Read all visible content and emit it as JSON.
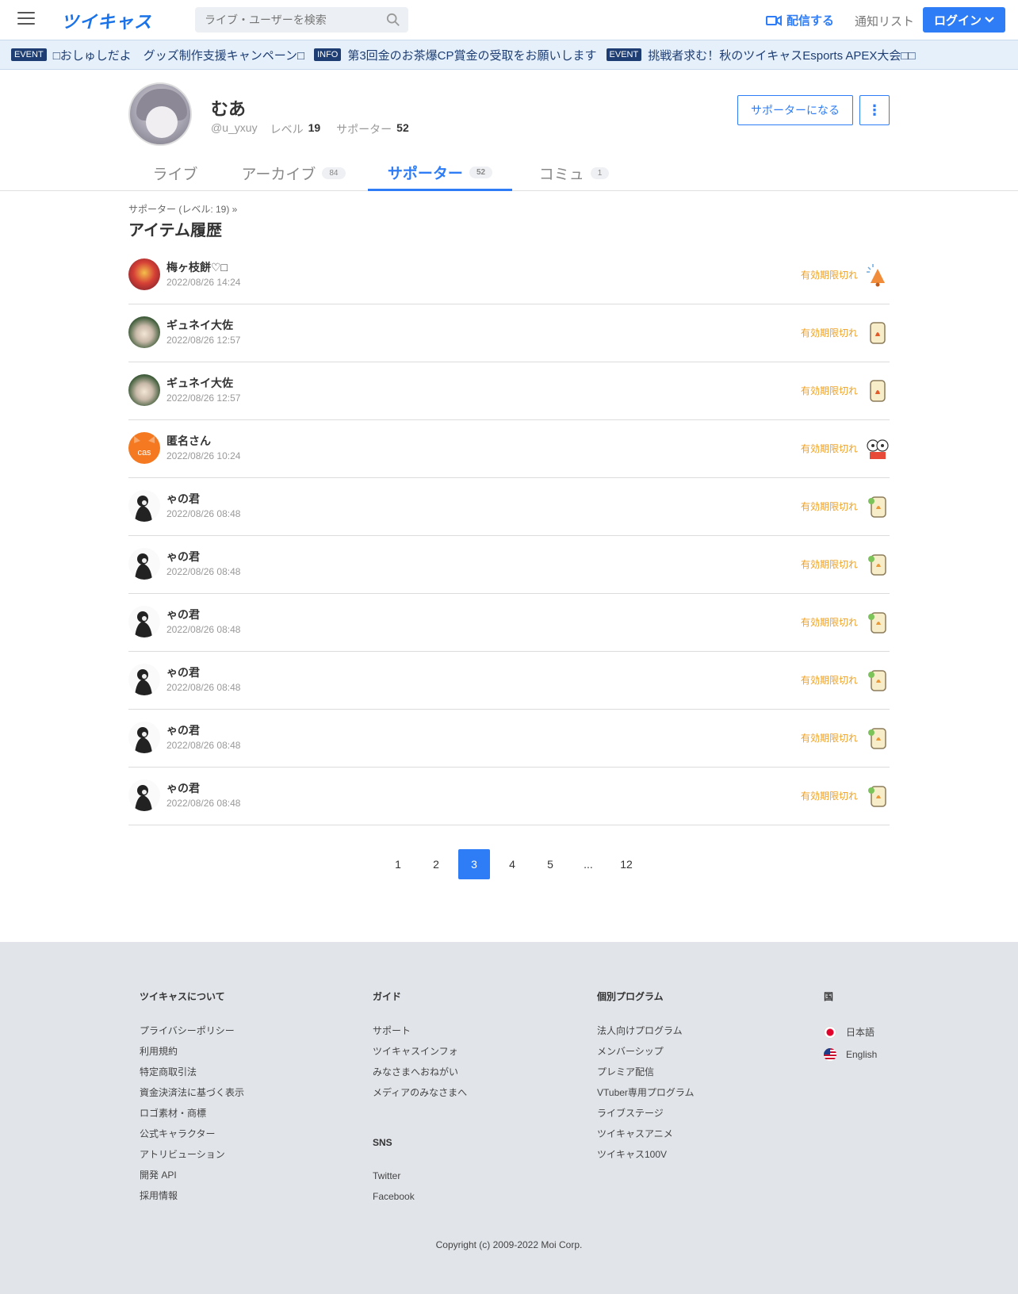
{
  "header": {
    "logo": "ツイキャス",
    "search_placeholder": "ライブ・ユーザーを検索",
    "broadcast_label": "配信する",
    "notify_label": "通知リスト",
    "login_label": "ログイン"
  },
  "ticker": [
    {
      "badge": "EVENT",
      "text": "□おしゅしだよ　グッズ制作支援キャンペーン□"
    },
    {
      "badge": "INFO",
      "text": "第3回金のお茶爆CP賞金の受取をお願いします"
    },
    {
      "badge": "EVENT",
      "text": "挑戦者求む！秋のツイキャスEsports APEX大会□□"
    }
  ],
  "profile": {
    "name": "むあ",
    "handle": "@u_yxuy",
    "level_label": "レベル",
    "level": "19",
    "supporter_label": "サポーター",
    "supporters": "52",
    "support_button": "サポーターになる"
  },
  "tabs": [
    {
      "label": "ライブ",
      "count": ""
    },
    {
      "label": "アーカイブ",
      "count": "84"
    },
    {
      "label": "サポーター",
      "count": "52",
      "active": true
    },
    {
      "label": "コミュ",
      "count": "1"
    }
  ],
  "breadcrumb": "サポーター (レベル: 19)  »",
  "page_title": "アイテム履歴",
  "status_label": "有効期限切れ",
  "items": [
    {
      "name": "梅ヶ枝餅♡□",
      "time": "2022/08/26 14:24",
      "avatar": "red",
      "item_icon": "bell-icon"
    },
    {
      "name": "ギュネイ大佐",
      "time": "2022/08/26 12:57",
      "avatar": "green",
      "item_icon": "card-icon"
    },
    {
      "name": "ギュネイ大佐",
      "time": "2022/08/26 12:57",
      "avatar": "green",
      "item_icon": "card-icon"
    },
    {
      "name": "匿名さん",
      "time": "2022/08/26 10:24",
      "avatar": "orange",
      "item_icon": "characters-icon"
    },
    {
      "name": "ゃの君",
      "time": "2022/08/26 08:48",
      "avatar": "dark",
      "item_icon": "clover-card-icon"
    },
    {
      "name": "ゃの君",
      "time": "2022/08/26 08:48",
      "avatar": "dark",
      "item_icon": "clover-card-icon"
    },
    {
      "name": "ゃの君",
      "time": "2022/08/26 08:48",
      "avatar": "dark",
      "item_icon": "clover-card-icon"
    },
    {
      "name": "ゃの君",
      "time": "2022/08/26 08:48",
      "avatar": "dark",
      "item_icon": "clover-card-icon"
    },
    {
      "name": "ゃの君",
      "time": "2022/08/26 08:48",
      "avatar": "dark",
      "item_icon": "clover-card-icon"
    },
    {
      "name": "ゃの君",
      "time": "2022/08/26 08:48",
      "avatar": "dark",
      "item_icon": "clover-card-icon"
    }
  ],
  "pagination": [
    "1",
    "2",
    "3",
    "4",
    "5",
    "...",
    "12"
  ],
  "pagination_active": "3",
  "footer": {
    "about": {
      "title": "ツイキャスについて",
      "links": [
        "プライバシーポリシー",
        "利用規約",
        "特定商取引法",
        "資金決済法に基づく表示",
        "ロゴ素材・商標",
        "公式キャラクター",
        "アトリビューション",
        "開発 API",
        "採用情報"
      ]
    },
    "guide": {
      "title": "ガイド",
      "links": [
        "サポート",
        "ツイキャスインフォ",
        "みなさまへおねがい",
        "メディアのみなさまへ"
      ]
    },
    "sns": {
      "title": "SNS",
      "links": [
        "Twitter",
        "Facebook"
      ]
    },
    "programs": {
      "title": "個別プログラム",
      "links": [
        "法人向けプログラム",
        "メンバーシップ",
        "プレミア配信",
        "VTuber専用プログラム",
        "ライブステージ",
        "ツイキャスアニメ",
        "ツイキャス100V"
      ]
    },
    "country": {
      "title": "国",
      "langs": [
        "日本語",
        "English"
      ]
    },
    "copyright": "Copyright (c) 2009-2022 Moi Corp."
  },
  "colors": {
    "accent": "#2e7df6",
    "expired": "#f0a020",
    "ticker_bg": "#e6f0fb",
    "footer_bg": "#e1e4e9"
  }
}
